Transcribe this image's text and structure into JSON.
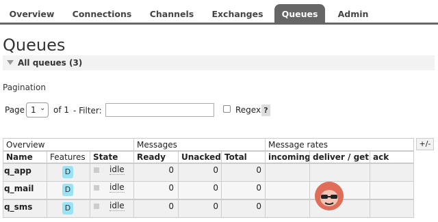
{
  "nav": {
    "tabs": [
      {
        "label": "Overview",
        "active": false
      },
      {
        "label": "Connections",
        "active": false
      },
      {
        "label": "Channels",
        "active": false
      },
      {
        "label": "Exchanges",
        "active": false
      },
      {
        "label": "Queues",
        "active": true
      },
      {
        "label": "Admin",
        "active": false
      }
    ],
    "accent": "#666666"
  },
  "page": {
    "title": "Queues",
    "section_title": "All queues (3)"
  },
  "pagination": {
    "heading": "Pagination",
    "page_label": "Page",
    "page_value": "1",
    "of_label": "of 1",
    "filter_label": "- Filter:",
    "filter_value": "",
    "regex_label": "Regex",
    "help_label": "?"
  },
  "table": {
    "plusminus_label": "+/-",
    "groups": {
      "overview": "Overview",
      "messages": "Messages",
      "message_rates": "Message rates"
    },
    "columns": {
      "name": "Name",
      "features": "Features",
      "state": "State",
      "ready": "Ready",
      "unacked": "Unacked",
      "total": "Total",
      "incoming": "incoming",
      "deliver_get": "deliver / get",
      "ack": "ack"
    },
    "rows": [
      {
        "name": "q_app",
        "feature": "D",
        "state": "idle",
        "ready": "0",
        "unacked": "0",
        "total": "0"
      },
      {
        "name": "q_mail",
        "feature": "D",
        "state": "idle",
        "ready": "0",
        "unacked": "0",
        "total": "0"
      },
      {
        "name": "q_sms",
        "feature": "D",
        "state": "idle",
        "ready": "0",
        "unacked": "0",
        "total": "0"
      }
    ],
    "feature_color": "#99e3f5"
  },
  "icons": {
    "section_toggle": "triangle-down-icon",
    "avatar": "avatar-icon"
  }
}
